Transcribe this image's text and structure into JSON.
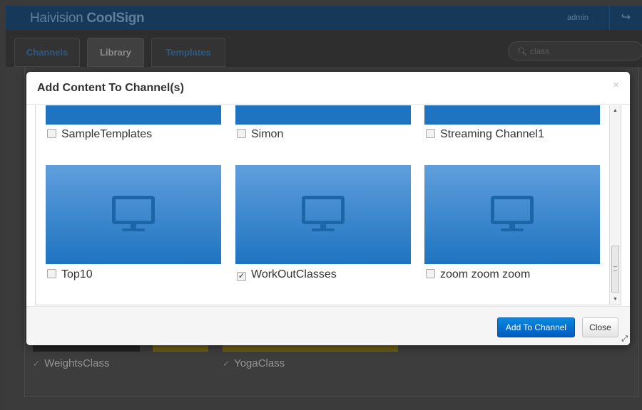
{
  "app": {
    "brand_light": "Haivision ",
    "brand_bold": "CoolSign",
    "user": "admin",
    "signout_icon": "↪"
  },
  "tabs": [
    {
      "label": "Channels"
    },
    {
      "label": "Library"
    },
    {
      "label": "Templates"
    }
  ],
  "search": {
    "value": "class",
    "icon": "search-icon"
  },
  "background_items": [
    {
      "label": "WeightsClass",
      "checked": true
    },
    {
      "label": "YogaClass",
      "checked": true
    }
  ],
  "modal": {
    "title": "Add Content To Channel(s)",
    "close_x": "×",
    "tiles": [
      {
        "label": "SampleTemplates",
        "checked": false
      },
      {
        "label": "Simon",
        "checked": false
      },
      {
        "label": "Streaming Channel1",
        "checked": false
      },
      {
        "label": "Top10",
        "checked": false
      },
      {
        "label": "WorkOutClasses",
        "checked": true
      },
      {
        "label": "zoom zoom zoom",
        "checked": false
      }
    ],
    "buttons": {
      "add": "Add To Channel",
      "close": "Close"
    }
  },
  "colors": {
    "accent": "#0a6fcf",
    "thumb_top": "#5f9edc",
    "thumb_bottom": "#1f74c1",
    "topbar": "#16395a"
  }
}
